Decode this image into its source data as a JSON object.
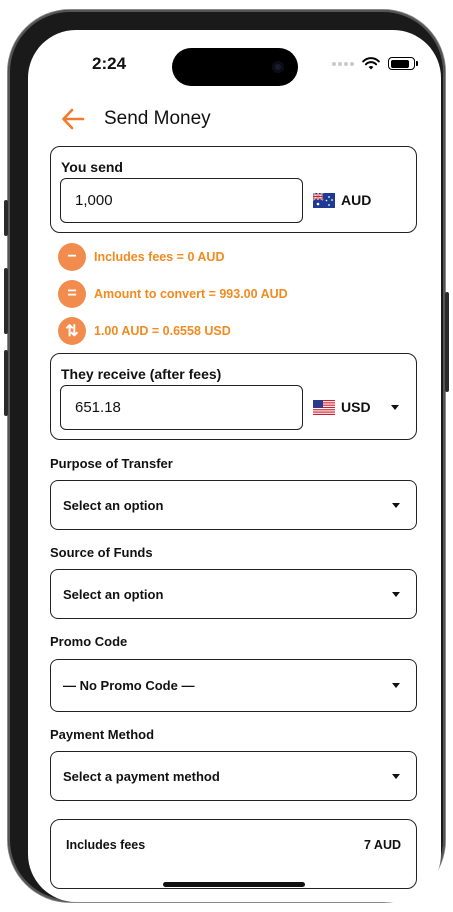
{
  "status_bar": {
    "time": "2:24",
    "battery_level": 0.85
  },
  "header": {
    "title": "Send Money",
    "back_icon": "arrow-left-icon"
  },
  "send": {
    "label": "You send",
    "amount": "1,000",
    "currency": "AUD",
    "flag": "australia-flag"
  },
  "fees": [
    {
      "icon": "minus-icon",
      "glyph": "−",
      "text": "Includes fees = 0 AUD"
    },
    {
      "icon": "equals-icon",
      "glyph": "=",
      "text": "Amount to convert = 993.00 AUD"
    },
    {
      "icon": "exchange-icon",
      "glyph": "⇅",
      "text": "1.00 AUD = 0.6558 USD"
    }
  ],
  "receive": {
    "label": "They receive (after fees)",
    "amount": "651.18",
    "currency": "USD",
    "flag": "us-flag"
  },
  "purpose": {
    "label": "Purpose of Transfer",
    "value": "Select an option"
  },
  "source": {
    "label": "Source of Funds",
    "value": "Select an option"
  },
  "promo": {
    "label": "Promo Code",
    "value": "— No Promo Code —"
  },
  "payment": {
    "label": "Payment Method",
    "value": "Select a payment method"
  },
  "summary": {
    "label": "Includes fees",
    "value": "7 AUD"
  },
  "colors": {
    "accent": "#F27B2E",
    "fee_text": "#F28A1F"
  }
}
